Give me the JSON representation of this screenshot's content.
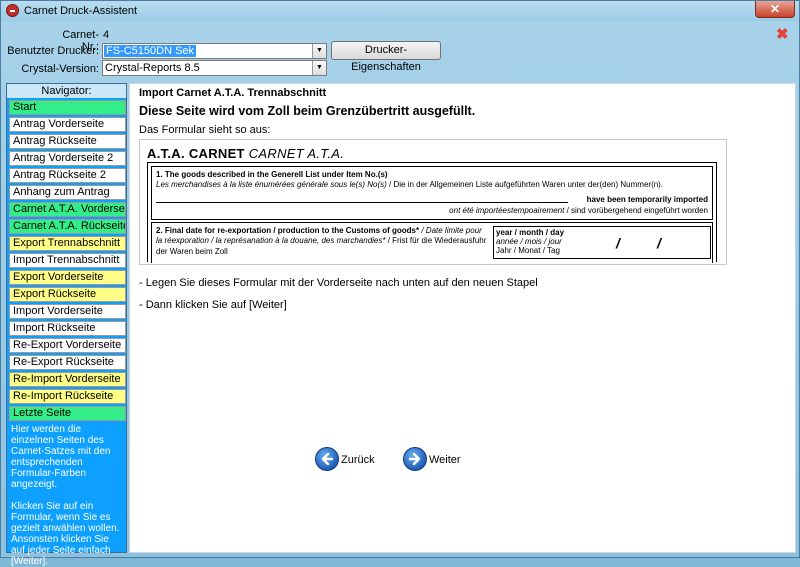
{
  "window": {
    "title": "Carnet Druck-Assistent"
  },
  "header": {
    "carnet_label": "Carnet-Nr.:",
    "carnet_value": "4",
    "printer_label": "Benutzter Drucker:",
    "printer_value": "FS-C5150DN Sek",
    "printer_props_button": "Drucker-Eigenschaften",
    "crystal_label": "Crystal-Version:",
    "crystal_value": "Crystal-Reports 8.5"
  },
  "colors": {
    "green": "#33ee88",
    "yellow": "#ffff88",
    "white": "#ffffff",
    "nav_bg": "#0ea0ff"
  },
  "navigator": {
    "header": "Navigator:",
    "items": [
      {
        "label": "Start",
        "color": "green"
      },
      {
        "label": "Antrag Vorderseite",
        "color": "white"
      },
      {
        "label": "Antrag Rückseite",
        "color": "white"
      },
      {
        "label": "Antrag Vorderseite 2",
        "color": "white"
      },
      {
        "label": "Antrag Rückseite 2",
        "color": "white"
      },
      {
        "label": "Anhang zum Antrag",
        "color": "white"
      },
      {
        "label": "Carnet A.T.A. Vorderseite",
        "color": "green"
      },
      {
        "label": "Carnet A.T.A. Rückseite",
        "color": "green"
      },
      {
        "label": "Export Trennabschnitt",
        "color": "yellow"
      },
      {
        "label": "Import Trennabschnitt",
        "color": "white"
      },
      {
        "label": "Export Vorderseite",
        "color": "yellow"
      },
      {
        "label": "Export Rückseite",
        "color": "yellow"
      },
      {
        "label": "Import Vorderseite",
        "color": "white"
      },
      {
        "label": "Import Rückseite",
        "color": "white"
      },
      {
        "label": "Re-Export Vorderseite",
        "color": "white"
      },
      {
        "label": "Re-Export Rückseite",
        "color": "white"
      },
      {
        "label": "Re-Import Vorderseite",
        "color": "yellow"
      },
      {
        "label": "Re-Import Rückseite",
        "color": "yellow"
      },
      {
        "label": "Letzte Seite",
        "color": "green"
      }
    ],
    "help_text_1": "Hier werden die einzelnen Seiten des Carnet-Satzes mit den entsprechenden Formular-Farben angezeigt.",
    "help_text_2": "Klicken Sie auf ein Formular, wenn Sie es gezielt anwählen wollen. Ansonsten klicken Sie auf jeder Seite einfach [Weiter]."
  },
  "content": {
    "section_title": "Import Carnet A.T.A. Trennabschnitt",
    "heading": "Diese Seite wird vom Zoll beim Grenzübertritt ausgefüllt.",
    "intro": "Das Formular sieht so aus:",
    "form": {
      "title": "A.T.A. CARNET",
      "title_italic": "CARNET A.T.A.",
      "f1_title": "1. The goods described in the Generell List under Item No.(s)",
      "f1_sub_italic": "Les merchandises à la liste énumérées générale sous le(s) No(s)",
      "f1_sub_de": " / Die in der Allgemeinen Liste aufgeführten Waren unter der(den) Nummer(n).",
      "f1_right_bold": "have been temporarily imported",
      "f1_right_italic": "ont été importéestempoairement",
      "f1_right_de": " / sind vorübergehend eingeführt worden",
      "f2_title": "2. Final date for re-exportation / production to the Customs of goods*",
      "f2_title_italic": " / Date limite pour",
      "f2_line2_italic": "la réexporation / la représanation à la douane, des marchandies*",
      "f2_line2_de": " / Frist für die Wiederausfuhr",
      "f2_line3": "der Waren beim Zoll",
      "date_en": "year / month / day",
      "date_fr": "année / mois / jour",
      "date_de": "Jahr / Monat / Tag",
      "date_sep": "/"
    },
    "instruction_1": "- Legen Sie dieses Formular mit der Vorderseite nach unten auf den neuen Stapel",
    "instruction_2": "- Dann klicken Sie auf [Weiter]",
    "back_button": "Zurück",
    "next_button": "Weiter"
  }
}
